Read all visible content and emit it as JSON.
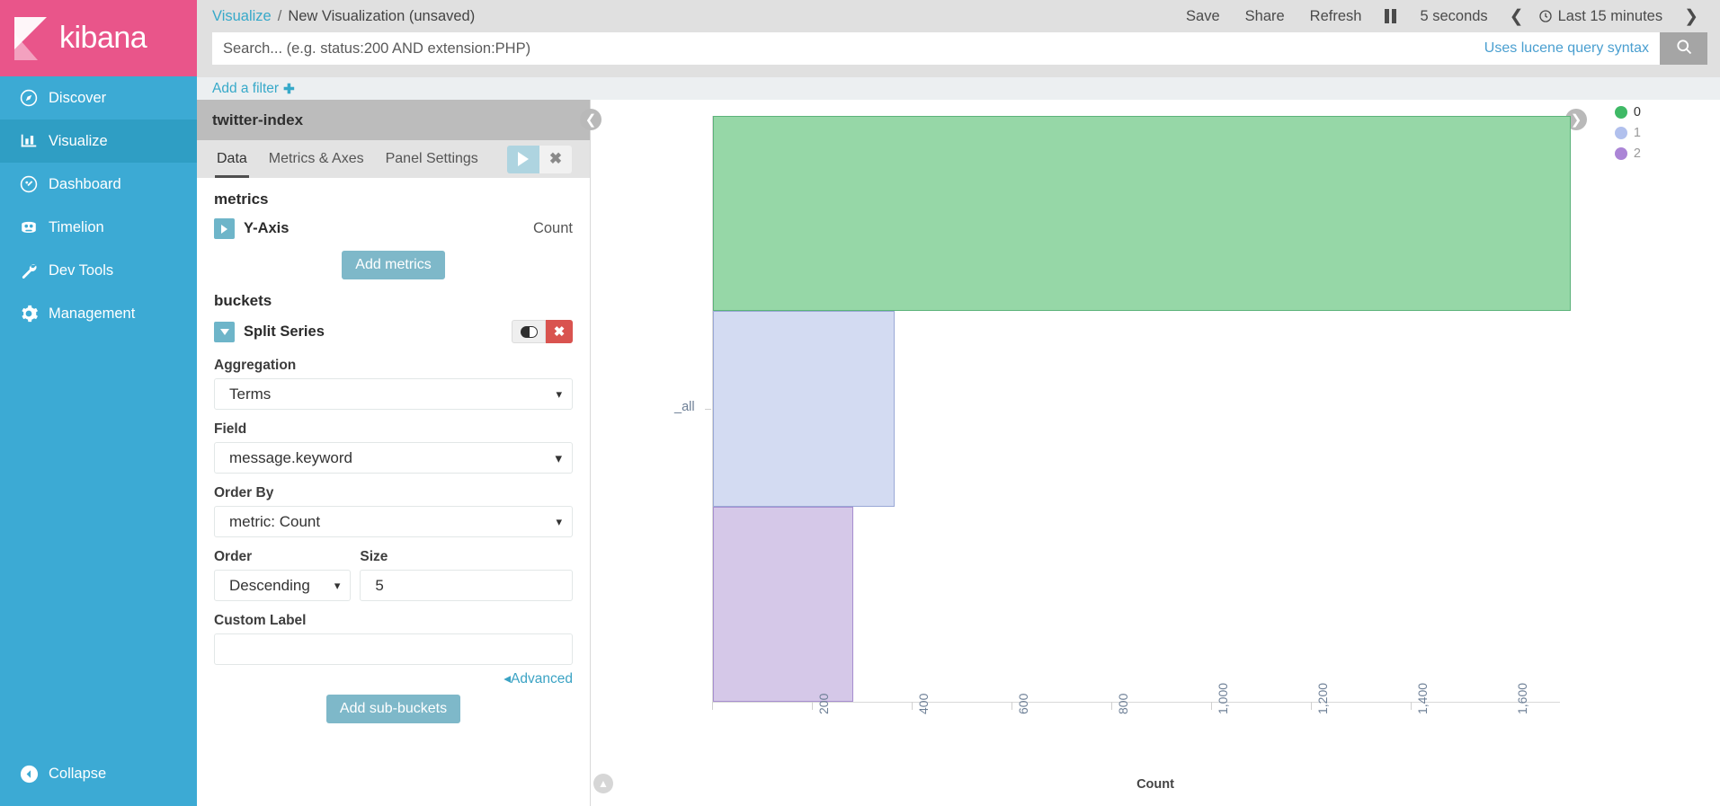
{
  "brand": {
    "name": "kibana",
    "logo_icon": "kibana-logo-icon",
    "color": "#e9558a"
  },
  "sidebar": {
    "items": [
      {
        "label": "Discover",
        "icon": "compass-icon",
        "active": false
      },
      {
        "label": "Visualize",
        "icon": "bar-chart-icon",
        "active": true
      },
      {
        "label": "Dashboard",
        "icon": "dashboard-icon",
        "active": false
      },
      {
        "label": "Timelion",
        "icon": "timelion-icon",
        "active": false
      },
      {
        "label": "Dev Tools",
        "icon": "wrench-icon",
        "active": false
      },
      {
        "label": "Management",
        "icon": "gear-icon",
        "active": false
      }
    ],
    "collapse": {
      "label": "Collapse",
      "icon": "chevron-left-circle-icon"
    }
  },
  "breadcrumb": {
    "parent": "Visualize",
    "separator": "/",
    "current": "New Visualization (unsaved)"
  },
  "topbar": {
    "save": "Save",
    "share": "Share",
    "refresh": "Refresh",
    "pause_icon": "pause-icon",
    "interval": "5 seconds",
    "prev_icon": "chevron-left-icon",
    "clock_icon": "clock-icon",
    "timerange": "Last 15 minutes",
    "next_icon": "chevron-right-icon"
  },
  "search": {
    "value": "",
    "placeholder": "Search... (e.g. status:200 AND extension:PHP)",
    "hint": "Uses lucene query syntax",
    "button_icon": "search-icon"
  },
  "filters": {
    "add_label": "Add a filter",
    "plus_icon": "plus-icon"
  },
  "config": {
    "index_title": "twitter-index",
    "tabs": [
      {
        "label": "Data",
        "active": true
      },
      {
        "label": "Metrics & Axes",
        "active": false
      },
      {
        "label": "Panel Settings",
        "active": false
      }
    ],
    "apply_icon": "play-icon",
    "close_icon": "close-icon",
    "metrics": {
      "heading": "metrics",
      "rows": [
        {
          "name": "Y-Axis",
          "value": "Count",
          "expand_icon": "caret-right-icon"
        }
      ],
      "add_label": "Add metrics"
    },
    "buckets": {
      "heading": "buckets",
      "row": {
        "name": "Split Series",
        "expand_icon": "caret-down-icon",
        "toggle_icon": "toggle-switch-icon",
        "delete_icon": "close-icon"
      },
      "fields": {
        "aggregation_label": "Aggregation",
        "aggregation_value": "Terms",
        "field_label": "Field",
        "field_value": "message.keyword",
        "order_by_label": "Order By",
        "order_by_value": "metric: Count",
        "order_label": "Order",
        "order_value": "Descending",
        "size_label": "Size",
        "size_value": "5",
        "custom_label_label": "Custom Label",
        "custom_label_value": "",
        "advanced": "Advanced",
        "advanced_icon": "caret-left-icon"
      },
      "add_sub_label": "Add sub-buckets"
    }
  },
  "chart_panel": {
    "collapse_panel_icon": "chevron-left-circle-icon",
    "legend_toggle_icon": "chevron-right-circle-icon",
    "scroll_up_icon": "chevron-up-circle-icon"
  },
  "chart_data": {
    "type": "bar",
    "orientation": "horizontal",
    "title": "",
    "xlabel": "Count",
    "ylabel": "",
    "categories": [
      "_all"
    ],
    "ytick_labels": [
      "_all"
    ],
    "xlim": [
      0,
      1700
    ],
    "xticks": [
      200,
      400,
      600,
      800,
      1000,
      1200,
      1400,
      1600
    ],
    "xtick_labels": [
      "200",
      "400",
      "600",
      "800",
      "1,000",
      "1,200",
      "1,400",
      "1,600"
    ],
    "grid": false,
    "legend_position": "right",
    "series": [
      {
        "name": "0",
        "values": [
          1720
        ],
        "color": "#96d7a7",
        "stroke": "#5cb37a"
      },
      {
        "name": "1",
        "values": [
          365
        ],
        "color": "#d3dbf2",
        "stroke": "#9aa8d6"
      },
      {
        "name": "2",
        "values": [
          282
        ],
        "color": "#d5c8e8",
        "stroke": "#a78fd0"
      }
    ]
  }
}
